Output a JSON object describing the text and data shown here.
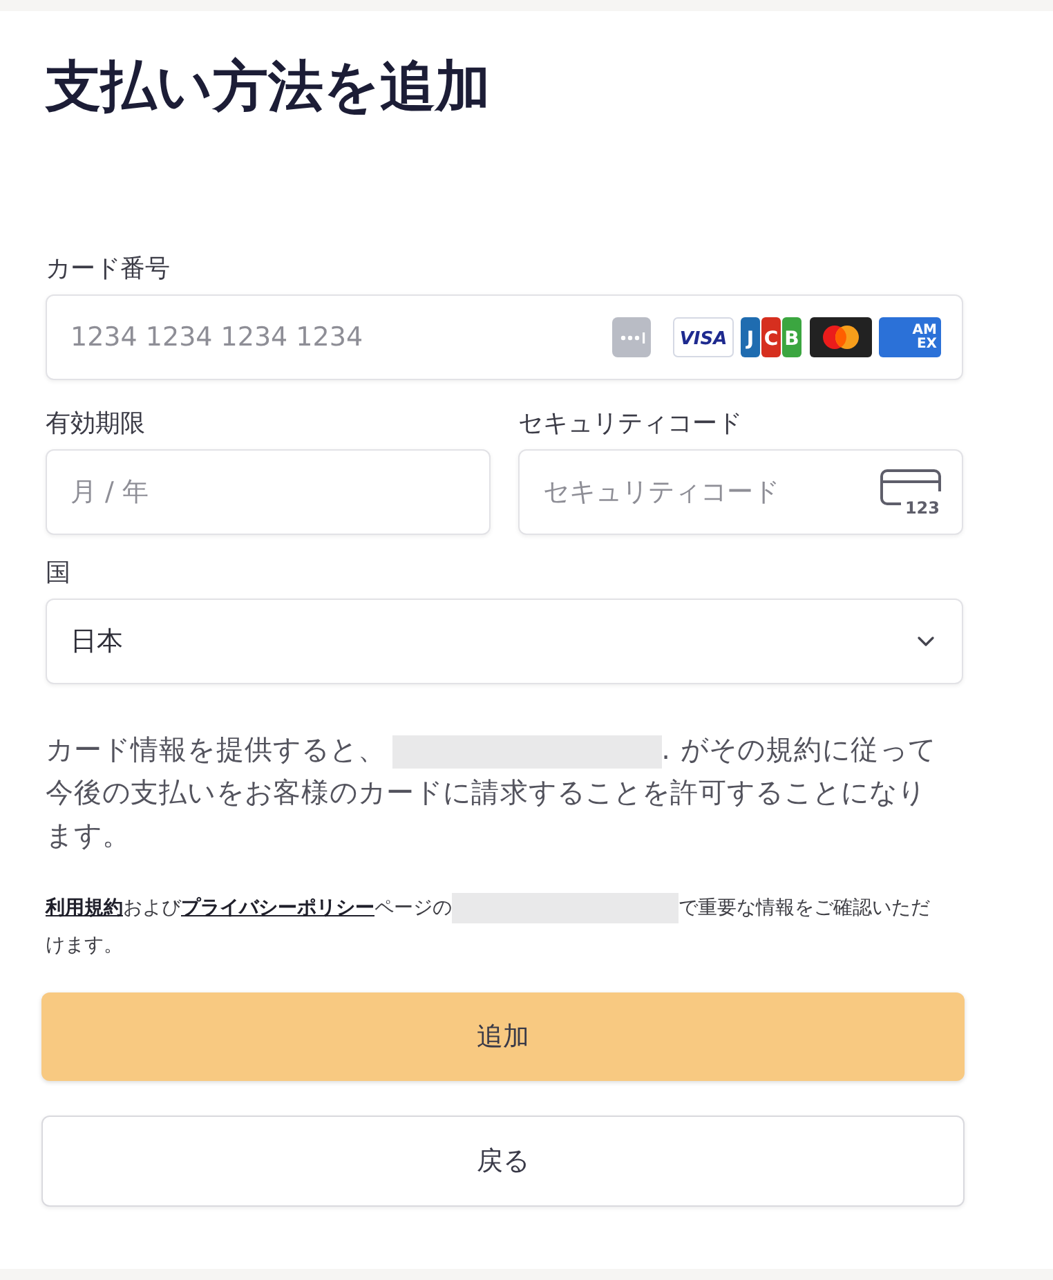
{
  "title": "支払い方法を追加",
  "card_number": {
    "label": "カード番号",
    "placeholder": "1234 1234 1234 1234",
    "brands": [
      {
        "kind": "generic"
      },
      {
        "kind": "visa",
        "text": "VISA"
      },
      {
        "kind": "jcb",
        "letters": [
          "J",
          "C",
          "B"
        ]
      },
      {
        "kind": "mastercard"
      },
      {
        "kind": "amex",
        "lines": [
          "AM",
          "EX"
        ]
      }
    ]
  },
  "expiry": {
    "label": "有効期限",
    "placeholder": "月 / 年"
  },
  "security_code": {
    "label": "セキュリティコード",
    "placeholder": "セキュリティコード",
    "icon_digits": "123"
  },
  "country": {
    "label": "国",
    "value": "日本"
  },
  "consent_text": [
    {
      "kind": "text",
      "text": "カード情報を提供すると、"
    },
    {
      "kind": "redacted"
    },
    {
      "kind": "text",
      "text": ". がその規約に従って今後の支払いをお客様のカードに請求することを許可することになります。"
    }
  ],
  "terms_notice": [
    {
      "kind": "link",
      "text": "利用規約"
    },
    {
      "kind": "text",
      "text": "および"
    },
    {
      "kind": "link",
      "text": "プライバシーポリシー"
    },
    {
      "kind": "text",
      "text": "ページの"
    },
    {
      "kind": "redacted"
    },
    {
      "kind": "text",
      "text": "で重要な情報をご確認いただけます。"
    }
  ],
  "buttons": [
    {
      "kind": "primary",
      "label": "追加"
    },
    {
      "kind": "secondary",
      "label": "戻る"
    }
  ]
}
